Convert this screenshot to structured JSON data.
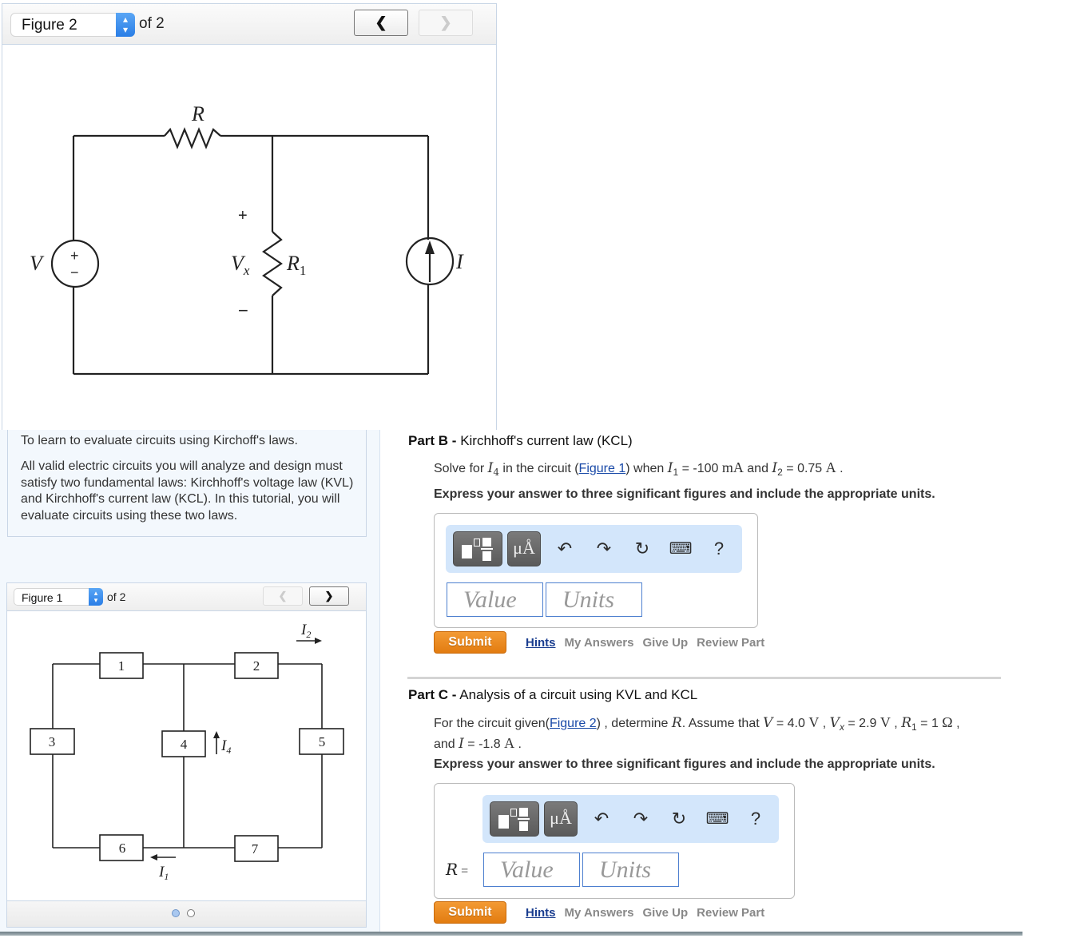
{
  "figure_viewer_top": {
    "select_value": "Figure 2",
    "of_label": "of 2",
    "prev_icon": "chevron-left-icon",
    "next_icon": "chevron-right-icon",
    "prev_enabled": true,
    "next_enabled": false,
    "diagram": {
      "labels": {
        "R": "R",
        "V": "V",
        "Vx": "V",
        "Vx_sub": "x",
        "R1": "R",
        "R1_sub": "1",
        "I": "I",
        "plus": "+",
        "minus": "−",
        "src_plus": "+",
        "src_minus": "−"
      }
    }
  },
  "intro": {
    "objective": "To learn to evaluate circuits using Kirchoff's laws.",
    "body": "All valid electric circuits you will analyze and design must satisfy two fundamental laws: Kirchhoff's voltage law (KVL) and Kirchhoff's current law (KCL). In this tutorial, you will evaluate circuits using these two laws."
  },
  "figure_viewer_bottom": {
    "select_value": "Figure 1",
    "of_label": "of 2",
    "prev_enabled": false,
    "next_enabled": true,
    "pager_dots": [
      {
        "active": true
      },
      {
        "active": false
      }
    ],
    "diagram": {
      "boxes": [
        "1",
        "2",
        "3",
        "4",
        "5",
        "6",
        "7"
      ],
      "currents": {
        "I1": "I",
        "I1_sub": "1",
        "I2": "I",
        "I2_sub": "2",
        "I4": "I",
        "I4_sub": "4"
      }
    }
  },
  "part_b": {
    "title_bold": "Part B -",
    "title": " Kirchhoff's current law (KCL)",
    "q_prefix": "Solve for ",
    "q_var": "I",
    "q_var_sub": "4",
    "q_mid1": " in the circuit (",
    "q_link": "Figure 1",
    "q_mid2": ") when ",
    "q_i1": "I",
    "q_i1_sub": "1",
    "q_i1_val": " = -100 ",
    "q_i1_unit": "mA",
    "q_and": " and ",
    "q_i2": "I",
    "q_i2_sub": "2",
    "q_i2_val": " = 0.75 ",
    "q_i2_unit": "A",
    "q_end": " .",
    "instruction": "Express your answer to three significant figures and include the appropriate units.",
    "value_placeholder": "Value",
    "units_placeholder": "Units"
  },
  "part_c": {
    "title_bold": "Part C -",
    "title": " Analysis of a circuit using KVL and KCL",
    "q_prefix": "For the circuit given(",
    "q_link": "Figure 2",
    "q_mid": ") , determine ",
    "q_R": "R",
    "q_assume": ". Assume that ",
    "q_V": "V",
    "q_V_val": " = 4.0 ",
    "q_V_unit": "V",
    "q_sep1": " , ",
    "q_Vx": "V",
    "q_Vx_sub": "x",
    "q_Vx_val": " = 2.9 ",
    "q_Vx_unit": "V",
    "q_sep2": " , ",
    "q_R1": "R",
    "q_R1_sub": "1",
    "q_R1_val": " = 1 ",
    "q_R1_unit": "Ω",
    "q_sep3": " ,",
    "q_and": "and ",
    "q_I": "I",
    "q_I_val": " = -1.8 ",
    "q_I_unit": "A",
    "q_end": " .",
    "instruction": "Express your answer to three significant figures and include the appropriate units.",
    "answer_label_var": "R",
    "answer_label_eq": " =",
    "value_placeholder": "Value",
    "units_placeholder": "Units"
  },
  "toolbar": {
    "template_icon": "fraction-template-icon",
    "units_label": "μÅ",
    "undo_icon": "undo-icon",
    "redo_icon": "redo-icon",
    "reset_icon": "reset-icon",
    "keyboard_icon": "keyboard-icon",
    "help_label": "?"
  },
  "actions": {
    "submit": "Submit",
    "hints": "Hints",
    "my_answers": "My Answers",
    "give_up": "Give Up",
    "review_part": "Review Part"
  },
  "colors": {
    "accent_orange": "#e8841a",
    "link_blue": "#1a4aa8",
    "toolbar_bg": "#d3e6fb",
    "panel_bg": "#f3f8fd"
  }
}
